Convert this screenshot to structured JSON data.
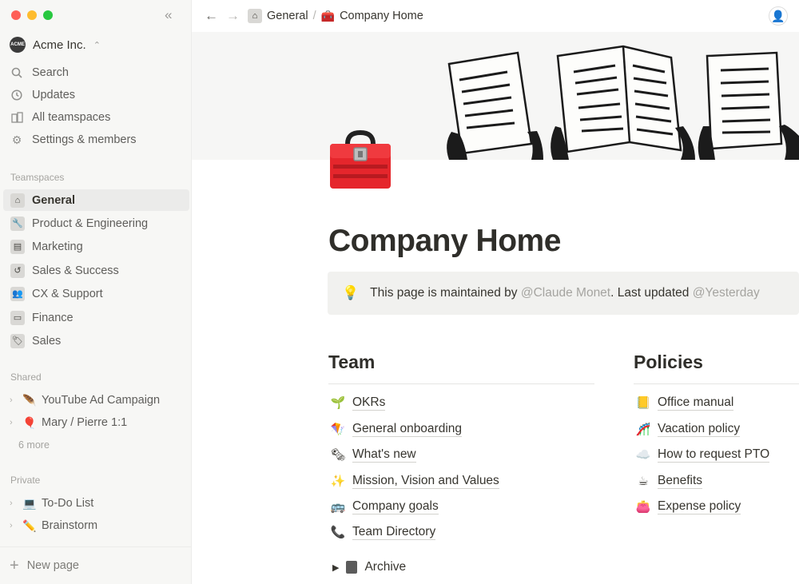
{
  "workspace": {
    "name": "Acme Inc.",
    "logo_text": "ACME"
  },
  "nav": [
    {
      "label": "Search",
      "icon": "search-icon"
    },
    {
      "label": "Updates",
      "icon": "clock-icon"
    },
    {
      "label": "All teamspaces",
      "icon": "buildings-icon"
    },
    {
      "label": "Settings & members",
      "icon": "gear-icon"
    }
  ],
  "teamspaces": {
    "label": "Teamspaces",
    "items": [
      {
        "label": "General",
        "icon": "home-icon",
        "active": true
      },
      {
        "label": "Product & Engineering",
        "icon": "wrench-icon"
      },
      {
        "label": "Marketing",
        "icon": "billboard-icon"
      },
      {
        "label": "Sales & Success",
        "icon": "history-icon"
      },
      {
        "label": "CX & Support",
        "icon": "people-icon"
      },
      {
        "label": "Finance",
        "icon": "money-icon"
      },
      {
        "label": "Sales",
        "icon": "tag-icon"
      }
    ]
  },
  "shared": {
    "label": "Shared",
    "items": [
      {
        "label": "YouTube Ad Campaign",
        "icon": "feather-icon"
      },
      {
        "label": "Mary / Pierre 1:1",
        "icon": "balloon-icon"
      }
    ],
    "more": "6 more"
  },
  "private": {
    "label": "Private",
    "items": [
      {
        "label": "To-Do List",
        "icon": "laptop-icon"
      },
      {
        "label": "Brainstorm",
        "icon": "pencil-icon"
      }
    ]
  },
  "new_page": "New page",
  "breadcrumb": {
    "parent": "General",
    "separator": "/",
    "current": "Company Home"
  },
  "page": {
    "title": "Company Home",
    "callout": {
      "prefix": "This page is maintained by",
      "maintainer": "@Claude Monet",
      "middle": ". Last updated",
      "updated": "@Yesterday"
    },
    "team": {
      "heading": "Team",
      "links": [
        {
          "label": "OKRs",
          "emoji": "🌱"
        },
        {
          "label": "General onboarding",
          "emoji": "🪁"
        },
        {
          "label": "What's new",
          "emoji": "🗞"
        },
        {
          "label": "Mission, Vision and Values",
          "emoji": "✨"
        },
        {
          "label": "Company goals",
          "emoji": "🚌"
        },
        {
          "label": "Team Directory",
          "emoji": "📞"
        }
      ],
      "toggle": "Archive"
    },
    "policies": {
      "heading": "Policies",
      "links": [
        {
          "label": "Office manual",
          "emoji": "📒"
        },
        {
          "label": "Vacation policy",
          "emoji": "🎢"
        },
        {
          "label": "How to request PTO",
          "emoji": "☁️"
        },
        {
          "label": "Benefits",
          "emoji": "☕"
        },
        {
          "label": "Expense policy",
          "emoji": "👛"
        }
      ]
    }
  }
}
